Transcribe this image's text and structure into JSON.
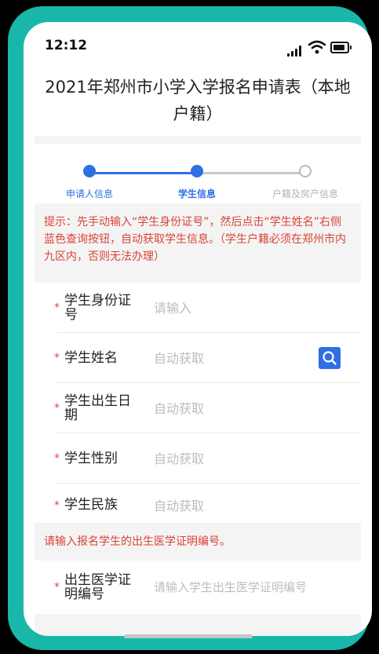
{
  "status_bar": {
    "time": "12:12"
  },
  "page": {
    "title": "2021年郑州市小学入学报名申请表（本地户籍）"
  },
  "steps": [
    {
      "label": "申请人信息",
      "state": "done"
    },
    {
      "label": "学生信息",
      "state": "current"
    },
    {
      "label": "户籍及房产信息",
      "state": "todo"
    }
  ],
  "hint": "提示：先手动输入“学生身份证号”，然后点击“学生姓名”右侧蓝色查询按钮，自动获取学生信息。（学生户籍必须在郑州市内九区内，否则无法办理）",
  "fields": {
    "id_number": {
      "label": "学生身份证号",
      "placeholder": "请输入"
    },
    "name": {
      "label": "学生姓名",
      "placeholder": "自动获取"
    },
    "birthdate": {
      "label": "学生出生日期",
      "placeholder": "自动获取"
    },
    "gender": {
      "label": "学生性别",
      "placeholder": "自动获取"
    },
    "ethnicity": {
      "label": "学生民族",
      "placeholder": "自动获取"
    },
    "birth_cert": {
      "label": "出生医学证明编号",
      "placeholder": "请输入学生出生医学证明编号"
    }
  },
  "notice": "请输入报名学生的出生医学证明编号。",
  "required_mark": "*",
  "colors": {
    "frame": "#19b7aa",
    "accent": "#2f6fe4",
    "warning": "#d94436"
  },
  "icons": {
    "search": "search-icon"
  }
}
